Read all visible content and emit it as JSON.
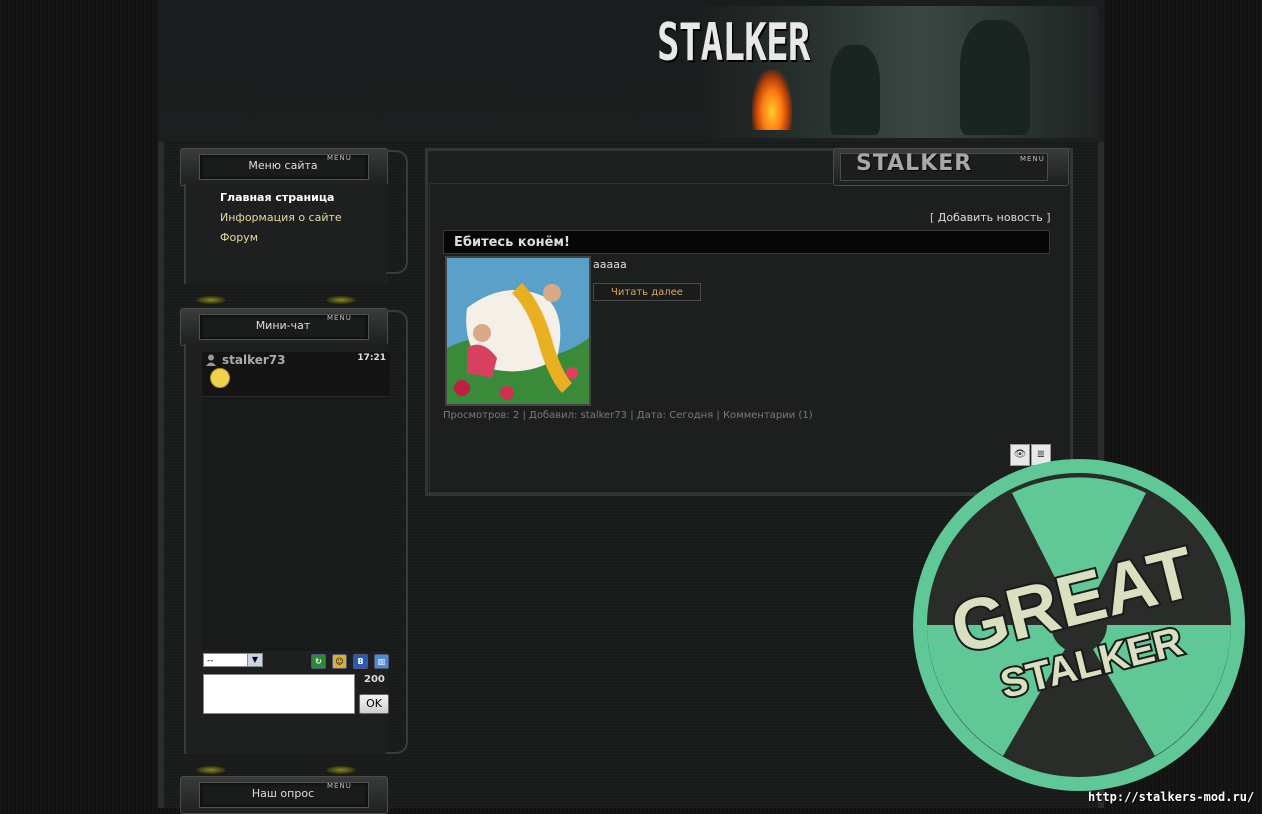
{
  "site": {
    "logo": "STALKER",
    "main_tag": "STALKER",
    "menu_tag": "MENU"
  },
  "menu_panel": {
    "title": "Меню сайта",
    "items": [
      {
        "label": "Главная страница",
        "active": true
      },
      {
        "label": "Информация о сайте"
      },
      {
        "label": "Форум"
      }
    ]
  },
  "chat_panel": {
    "title": "Мини-чат",
    "message": {
      "user": "stalker73",
      "time": "17:21"
    },
    "select_value": "--",
    "char_count": "200",
    "ok_label": "OK",
    "tools": [
      "refresh-icon",
      "smiles-icon",
      "bbcode-icon",
      "rules-icon"
    ]
  },
  "poll_panel": {
    "title": "Наш опрос"
  },
  "main": {
    "add_news": "Добавить новость",
    "news": {
      "title": "Ебитесь конём!",
      "text": "ааааа",
      "read_more": "Читать далее",
      "meta": {
        "views_label": "Просмотров:",
        "views": "2",
        "added_label": "Добавил:",
        "author": "stalker73",
        "date_label": "Дата:",
        "date": "Сегодня",
        "comments": "Комментарии (1)"
      }
    }
  },
  "watermark": {
    "line1": "GREAT",
    "line2": "STALKER",
    "url": "http://stalkers-mod.ru/"
  },
  "colors": {
    "accent_gold": "#e8d8a0",
    "read_more": "#d8a85a",
    "watermark_green": "#5fc896"
  }
}
